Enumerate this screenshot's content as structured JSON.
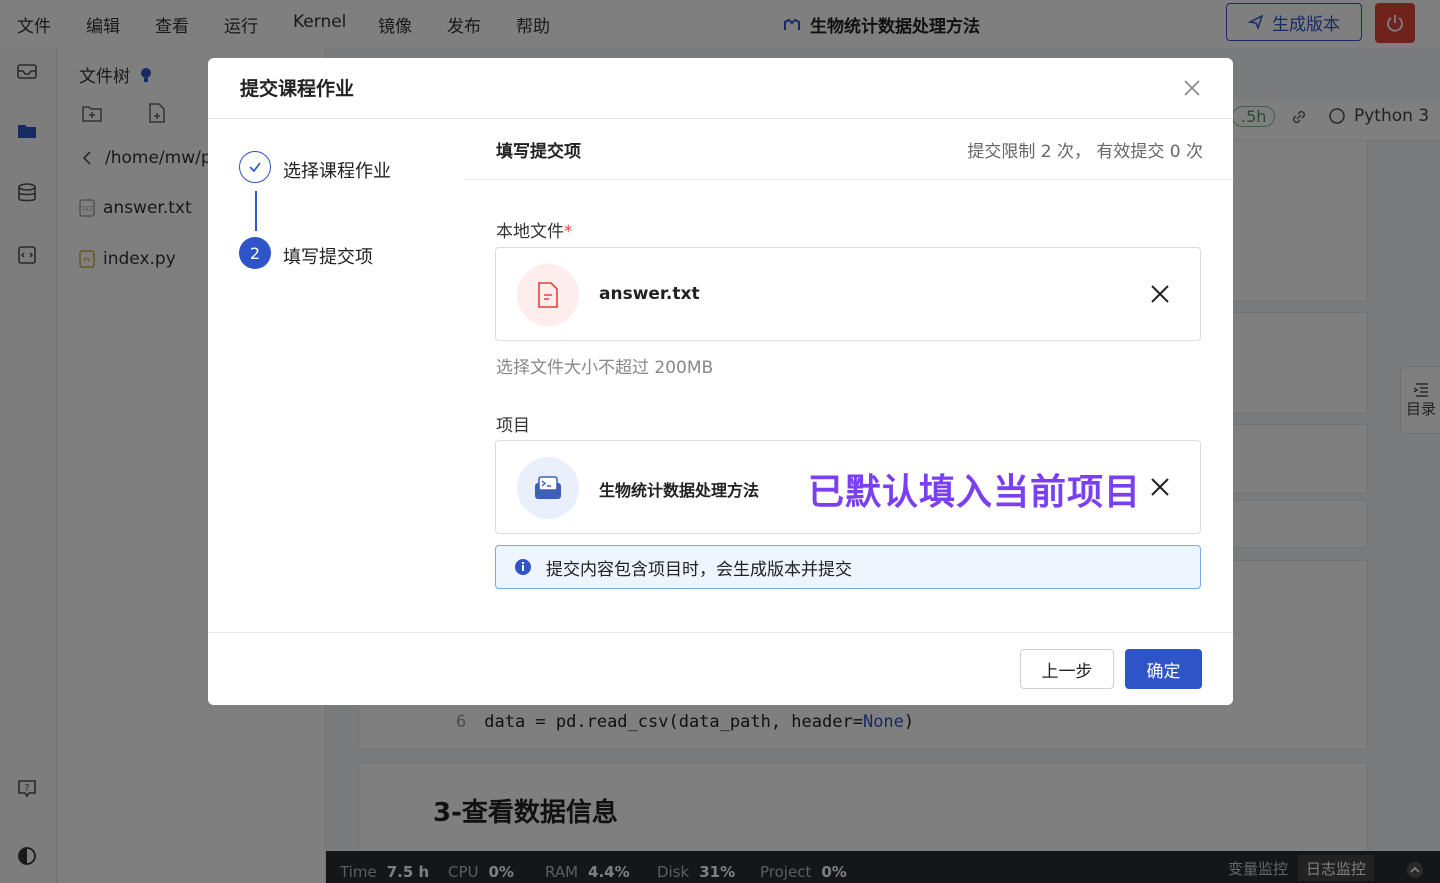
{
  "menu": [
    "文件",
    "编辑",
    "查看",
    "运行",
    "Kernel",
    "镜像",
    "发布",
    "帮助"
  ],
  "app_title": "生物统计数据处理方法",
  "toolbar": {
    "generate_version": "生成版本"
  },
  "file_tree": {
    "title": "文件树",
    "path": "/home/mw/p",
    "files": [
      "answer.txt",
      "index.py"
    ]
  },
  "kernel": {
    "runtime_badge": ".5h",
    "name": "Python 3"
  },
  "toc_label": "目录",
  "code": {
    "line_no": "6",
    "text": "data = pd.read_csv(data_path, header=",
    "keyword": "None",
    "tail": ")"
  },
  "section_heading": "3-查看数据信息",
  "status": {
    "time_label": "Time",
    "time_value": "7.5 h",
    "cpu_label": "CPU",
    "cpu_value": "0%",
    "ram_label": "RAM",
    "ram_value": "4.4%",
    "disk_label": "Disk",
    "disk_value": "31%",
    "project_label": "Project",
    "project_value": "0%",
    "var_monitor": "变量监控",
    "log_monitor": "日志监控"
  },
  "modal": {
    "title": "提交课程作业",
    "steps": [
      {
        "label": "选择课程作业",
        "state": "done"
      },
      {
        "label": "填写提交项",
        "number": "2",
        "state": "active"
      }
    ],
    "section_title": "填写提交项",
    "limit_text": "提交限制 2 次， 有效提交 0 次",
    "local_file_label": "本地文件",
    "required_mark": "*",
    "local_file_name": "answer.txt",
    "size_hint": "选择文件大小不超过 200MB",
    "project_label": "项目",
    "project_name": "生物统计数据处理方法",
    "project_annotation": "已默认填入当前项目",
    "notice": "提交内容包含项目时，会生成版本并提交",
    "prev_button": "上一步",
    "ok_button": "确定"
  },
  "colors": {
    "primary": "#2f54c7",
    "danger": "#e0453a",
    "annotation": "#7b3ff2"
  }
}
